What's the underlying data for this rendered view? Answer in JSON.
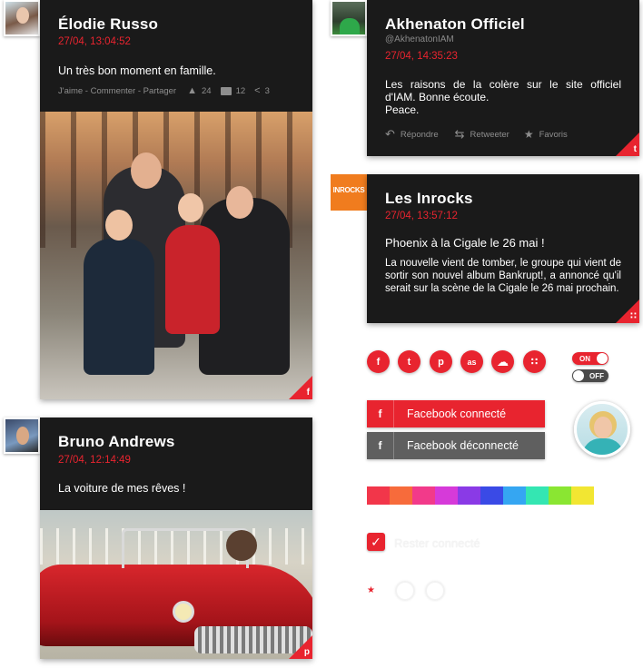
{
  "colors": {
    "accent": "#e8242f",
    "card": "#1a1a1a",
    "grey_button": "#5f5f5f"
  },
  "elodie": {
    "name": "Élodie Russo",
    "date": "27/04, 13:04:52",
    "message": "Un très bon moment en famille.",
    "actions_text": "J'aime - Commenter - Partager",
    "likes": "24",
    "comments": "12",
    "shares": "3",
    "network_icon": "facebook-icon",
    "corner_glyph": "f"
  },
  "akhenaton": {
    "name": "Akhenaton Officiel",
    "handle": "@AkhenatonIAM",
    "date": "27/04, 14:35:23",
    "message_lines": [
      "Les raisons de la colère sur le site officiel",
      "d'IAM. Bonne écoute.",
      "Peace."
    ],
    "reply_label": "Répondre",
    "retweet_label": "Retweeter",
    "favorite_label": "Favoris",
    "network_icon": "twitter-icon",
    "corner_glyph": "t"
  },
  "inrocks": {
    "logo_text": "INROCKS",
    "name": "Les Inrocks",
    "date": "27/04, 13:57:12",
    "headline": "Phoenix à la Cigale le 26 mai !",
    "message": "La nouvelle vient de tomber, le groupe qui vient de sortir son nouvel album Bankrupt!, a annoncé qu'il serait sur la scène de la Cigale le 26 mai prochain.",
    "network_icon": "rss-icon",
    "corner_glyph": "∷"
  },
  "bruno": {
    "name": "Bruno Andrews",
    "date": "27/04, 12:14:49",
    "message": "La voiture de mes rêves !",
    "network_icon": "pinterest-icon",
    "corner_glyph": "p"
  },
  "social_icons": [
    {
      "name": "facebook-icon",
      "glyph": "f"
    },
    {
      "name": "twitter-icon",
      "glyph": "t"
    },
    {
      "name": "pinterest-icon",
      "glyph": "p"
    },
    {
      "name": "lastfm-icon",
      "glyph": "as"
    },
    {
      "name": "soundcloud-icon",
      "glyph": "☁"
    },
    {
      "name": "rss-icon",
      "glyph": "∷"
    }
  ],
  "toggles": {
    "on_label": "ON",
    "off_label": "OFF"
  },
  "facebook_buttons": {
    "glyph": "f",
    "connected_label": "Facebook connecté",
    "disconnected_label": "Facebook déconnecté"
  },
  "palette": [
    "#f2364a",
    "#f76b3b",
    "#f23a8a",
    "#d63ad9",
    "#8a3ae6",
    "#3a4ae6",
    "#35a6f2",
    "#34e6b2",
    "#8ae632",
    "#f2e632"
  ],
  "checkbox": {
    "checked": true,
    "label": "Rester connecté"
  },
  "rating": {
    "star": "★"
  }
}
